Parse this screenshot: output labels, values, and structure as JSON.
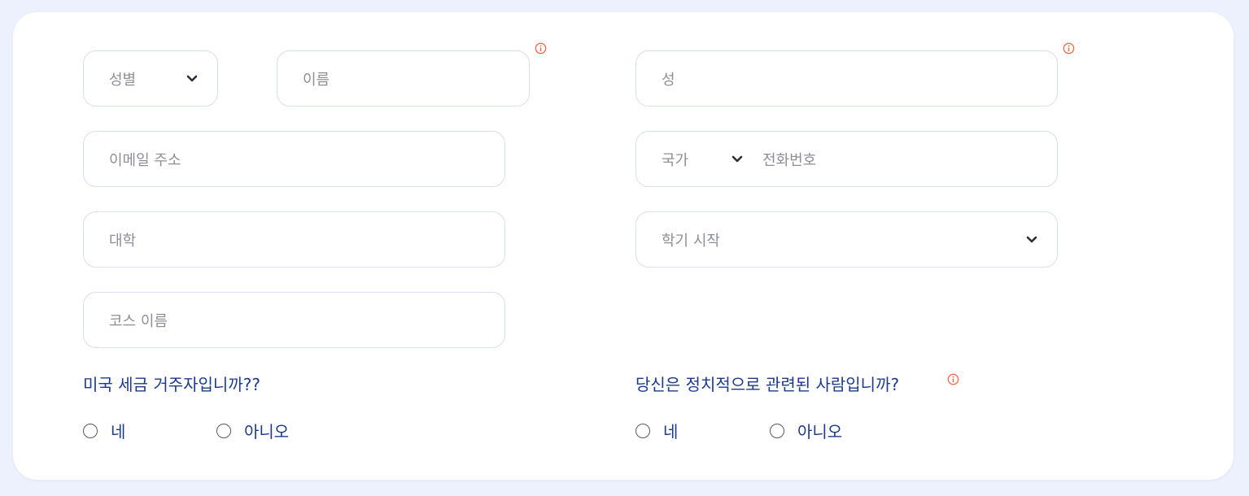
{
  "form": {
    "gender": {
      "placeholder": "성별",
      "icon": "chevron-down-icon"
    },
    "first_name": {
      "placeholder": "이름"
    },
    "last_name": {
      "placeholder": "성"
    },
    "email": {
      "placeholder": "이메일 주소"
    },
    "phone": {
      "country_placeholder": "국가",
      "number_placeholder": "전화번호"
    },
    "university": {
      "placeholder": "대학"
    },
    "semester_start": {
      "placeholder": "학기 시작"
    },
    "course_name": {
      "placeholder": "코스 이름"
    }
  },
  "questions": {
    "us_tax": {
      "label": "미국 세금 거주자입니까??",
      "options": [
        "네",
        "아니오"
      ]
    },
    "pep": {
      "label": "당신은 정치적으로 관련된 사람입니까?",
      "options": [
        "네",
        "아니오"
      ]
    }
  },
  "colors": {
    "background": "#edf1fd",
    "card": "#ffffff",
    "border": "#d9def0",
    "placeholder": "#8d8f98",
    "question_text": "#1b3a8b",
    "info_icon": "#f26a4b"
  }
}
